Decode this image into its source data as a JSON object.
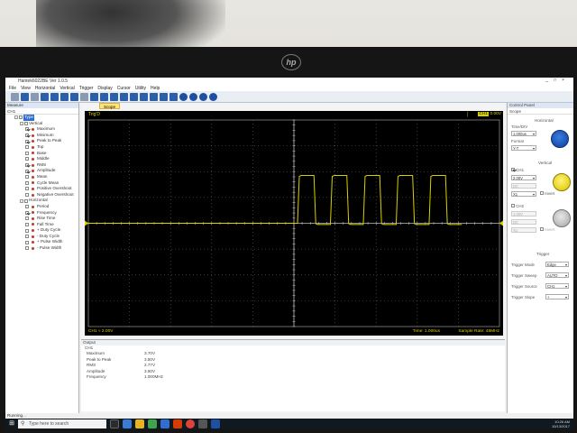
{
  "brand": {
    "logo": "hp"
  },
  "window": {
    "title": "Hantek6022BE Ver 1.0.5",
    "controls": [
      "_",
      "□",
      "×"
    ]
  },
  "menu": [
    "File",
    "View",
    "Horizontal",
    "Vertical",
    "Trigger",
    "Display",
    "Cursor",
    "Utility",
    "Help"
  ],
  "left_panel": {
    "header": "Measure",
    "channel": "CH1",
    "root": "Type",
    "vertical_label": "Vertical",
    "vertical_items": [
      {
        "label": "Maximum",
        "checked": true
      },
      {
        "label": "Minimum",
        "checked": true
      },
      {
        "label": "Peak to Peak",
        "checked": true
      },
      {
        "label": "Top",
        "checked": false
      },
      {
        "label": "Base",
        "checked": false
      },
      {
        "label": "Middle",
        "checked": false
      },
      {
        "label": "RMS",
        "checked": true
      },
      {
        "label": "Amplitude",
        "checked": true
      },
      {
        "label": "Mean",
        "checked": false
      },
      {
        "label": "Cycle Mean",
        "checked": false
      },
      {
        "label": "Positive Overshoot",
        "checked": false
      },
      {
        "label": "Negative Overshoot",
        "checked": false
      }
    ],
    "horizontal_label": "Horizontal",
    "horizontal_items": [
      {
        "label": "Period",
        "checked": false
      },
      {
        "label": "Frequency",
        "checked": true
      },
      {
        "label": "Rise Time",
        "checked": false
      },
      {
        "label": "Fall Time",
        "checked": false
      },
      {
        "label": "+ Duty Cycle",
        "checked": false
      },
      {
        "label": "- Duty Cycle",
        "checked": false
      },
      {
        "label": "+ Pulse Width",
        "checked": false
      },
      {
        "label": "- Pulse Width",
        "checked": false
      }
    ]
  },
  "scope": {
    "tab_label": "Scope",
    "trig_status": "Trig'D",
    "ch1_tag": "CH1",
    "trigger_level": "0.00V",
    "ch1_scale": "CH1 ≈  2.00V",
    "time": "Time: 1.000us",
    "sample_rate": "Sample Rate: 48MHz",
    "trace_color": "#d8d000",
    "grid_color": "#6a6a6a"
  },
  "output": {
    "title": "Output",
    "channel": "CH1",
    "rows": [
      {
        "name": "Maximum",
        "value": "3.70V"
      },
      {
        "name": "Peak to Peak",
        "value": "3.80V"
      },
      {
        "name": "RMS",
        "value": "2.77V"
      },
      {
        "name": "Amplitude",
        "value": "3.80V"
      },
      {
        "name": "Frequency",
        "value": "1.000MHz"
      }
    ]
  },
  "right_panel": {
    "header": "Control Panel",
    "mode": "Scope",
    "horizontal_title": "Horizontal",
    "time_div_label": "Time/DIV",
    "time_div_value": "1.000us",
    "format_label": "Format",
    "format_value": "Y-T",
    "vertical_title": "Vertical",
    "ch1_label": "CH1",
    "ch1_volts": "2.00V",
    "ch1_coupling": "DC",
    "ch1_probe": "X1",
    "invert_label": "Invert",
    "ch2_label": "CH2",
    "ch2_volts": "1.00V",
    "ch2_coupling": "DC",
    "ch2_probe": "X1",
    "invert2_label": "Invert",
    "trigger_title": "Trigger",
    "trigger_mode_label": "Trigger Mode",
    "trigger_mode_value": "Edge",
    "trigger_sweep_label": "Trigger Sweep",
    "trigger_sweep_value": "AUTO",
    "trigger_source_label": "Trigger Source",
    "trigger_source_value": "CH1",
    "trigger_slope_label": "Trigger Slope",
    "trigger_slope_value": "+"
  },
  "status": "Running...",
  "taskbar": {
    "search_placeholder": "Type here to search",
    "time": "10:26 AM",
    "date": "10/13/2017"
  },
  "waveform": {
    "period_us": 1.0,
    "duty_cycle": 0.5,
    "pulses": 5,
    "high_v": 3.7,
    "low_v": -0.1,
    "volts_per_div": 2.0
  }
}
